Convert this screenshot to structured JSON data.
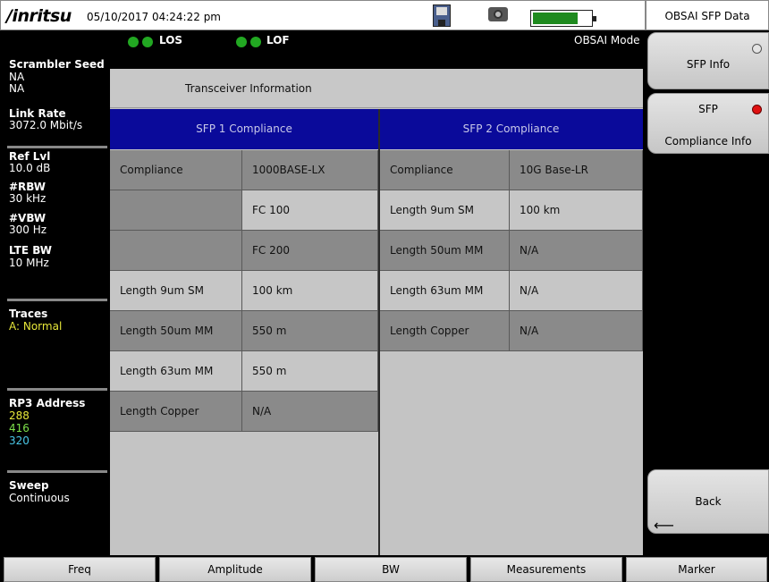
{
  "header": {
    "logo": "/inritsu",
    "datetime": "05/10/2017 04:24:22 pm"
  },
  "icons": {
    "save": "floppy-disk-icon",
    "camera": "camera-icon",
    "battery": "battery-icon",
    "battery_level": 0.75
  },
  "right_panel": {
    "title": "OBSAI SFP Data",
    "buttons": [
      {
        "label": "SFP Info"
      },
      {
        "label1": "SFP",
        "label2": "Compliance Info"
      },
      {
        "label": "Back",
        "arrow": "⟵"
      }
    ]
  },
  "indicators": {
    "los": "LOS",
    "lof": "LOF",
    "mode": "OBSAI Mode",
    "status_color": "#22a822"
  },
  "left_panel": {
    "scrambler_label": "Scrambler Seed",
    "scrambler_values": [
      "NA",
      "NA"
    ],
    "link_rate_label": "Link Rate",
    "link_rate_value": "3072.0 Mbit/s",
    "ref_lvl_label": "Ref Lvl",
    "ref_lvl_value": "10.0 dB",
    "rbw_label": "#RBW",
    "rbw_value": "30 kHz",
    "vbw_label": "#VBW",
    "vbw_value": "300 Hz",
    "lte_bw_label": "LTE BW",
    "lte_bw_value": "10 MHz",
    "traces_label": "Traces",
    "traces_value": "A: Normal",
    "rp3_label": "RP3 Address",
    "rp3_values": [
      "288",
      "416",
      "320"
    ],
    "sweep_label": "Sweep",
    "sweep_value": "Continuous"
  },
  "content": {
    "title": "Transceiver Information",
    "sfp1_header": "SFP 1 Compliance",
    "sfp2_header": "SFP 2 Compliance",
    "sfp1_rows": [
      {
        "label": "Compliance",
        "value": "1000BASE-LX"
      },
      {
        "label": "",
        "value": "FC 100"
      },
      {
        "label": "",
        "value": "FC 200"
      },
      {
        "label": "Length 9um SM",
        "value": "100 km"
      },
      {
        "label": "Length 50um MM",
        "value": "550 m"
      },
      {
        "label": "Length 63um MM",
        "value": "550 m"
      },
      {
        "label": "Length Copper",
        "value": "N/A"
      }
    ],
    "sfp2_rows": [
      {
        "label": "Compliance",
        "value": "10G Base-LR"
      },
      {
        "label": "Length 9um SM",
        "value": "100 km"
      },
      {
        "label": "Length 50um MM",
        "value": "N/A"
      },
      {
        "label": "Length 63um MM",
        "value": "N/A"
      },
      {
        "label": "Length Copper",
        "value": "N/A"
      }
    ]
  },
  "bottom_menu": [
    "Freq",
    "Amplitude",
    "BW",
    "Measurements",
    "Marker"
  ]
}
